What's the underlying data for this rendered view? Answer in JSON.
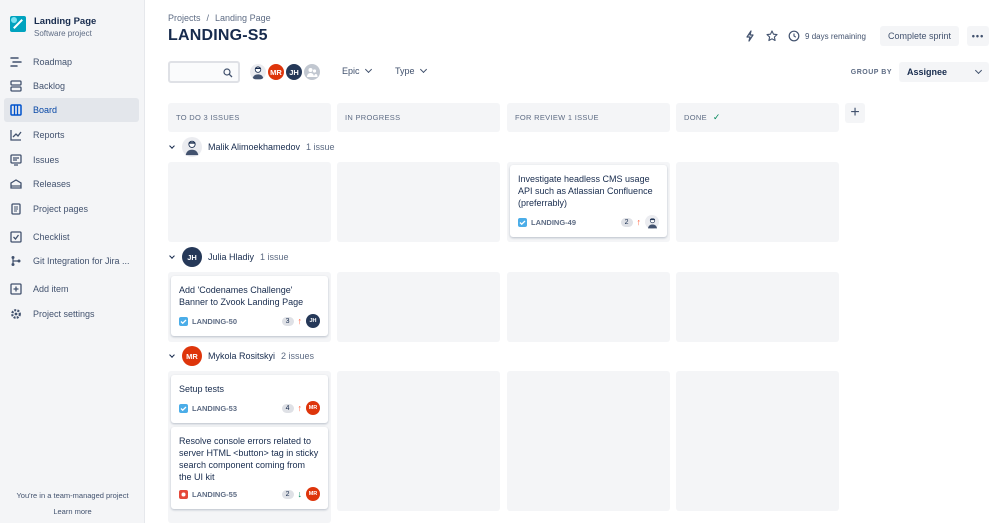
{
  "project": {
    "name": "Landing Page",
    "type": "Software project"
  },
  "sidebar": {
    "items": [
      {
        "label": "Roadmap",
        "icon": "roadmap-icon"
      },
      {
        "label": "Backlog",
        "icon": "backlog-icon"
      },
      {
        "label": "Board",
        "icon": "board-icon",
        "active": true
      },
      {
        "label": "Reports",
        "icon": "reports-icon"
      },
      {
        "label": "Issues",
        "icon": "issues-icon"
      },
      {
        "label": "Releases",
        "icon": "releases-icon"
      },
      {
        "label": "Project pages",
        "icon": "pages-icon"
      },
      {
        "label": "Checklist",
        "icon": "checklist-icon"
      },
      {
        "label": "Git Integration for Jira ...",
        "icon": "git-icon"
      },
      {
        "label": "Add item",
        "icon": "add-item-icon"
      },
      {
        "label": "Project settings",
        "icon": "gear-icon"
      }
    ],
    "footer_text": "You're in a team-managed project",
    "footer_link": "Learn more"
  },
  "breadcrumb": {
    "projects": "Projects",
    "sep": "/",
    "project": "Landing Page"
  },
  "page_title": "LANDING-S5",
  "header": {
    "days_remaining": "9 days remaining",
    "complete_sprint": "Complete sprint",
    "more": "•••"
  },
  "filters": {
    "search_placeholder": "",
    "avatars": [
      "",
      "MR",
      "JH",
      ""
    ],
    "epic": "Epic",
    "type": "Type",
    "group_by_label": "GROUP BY",
    "group_by_value": "Assignee"
  },
  "columns": [
    {
      "label": "TO DO 3 ISSUES"
    },
    {
      "label": "IN PROGRESS"
    },
    {
      "label": "FOR REVIEW 1 ISSUE"
    },
    {
      "label": "DONE"
    }
  ],
  "add_column": "+",
  "swimlanes": [
    {
      "assignee": "Malik Alimoekhamedov",
      "count": "1 issue",
      "initials": "",
      "cards": [
        {
          "title": "Investigate headless CMS usage API such as Atlassian Confluence (preferrably)",
          "key": "LANDING-49",
          "type": "task",
          "estimate": "2",
          "priority": "↑",
          "assignee_initials": ""
        }
      ]
    },
    {
      "assignee": "Julia Hladiy",
      "count": "1 issue",
      "initials": "JH",
      "cards": [
        {
          "title": "Add 'Codenames Challenge' Banner to Zvook Landing Page",
          "key": "LANDING-50",
          "type": "task",
          "estimate": "3",
          "priority": "↑",
          "assignee_initials": "JH"
        }
      ]
    },
    {
      "assignee": "Mykola Rositskyi",
      "count": "2 issues",
      "initials": "MR",
      "cards": [
        {
          "title": "Setup tests",
          "key": "LANDING-53",
          "type": "task",
          "estimate": "4",
          "priority": "↑",
          "assignee_initials": "MR"
        },
        {
          "title": "Resolve console errors related to server HTML <button> tag in sticky search component coming from the UI kit",
          "key": "LANDING-55",
          "type": "bug",
          "estimate": "2",
          "priority": "↓",
          "assignee_initials": "MR"
        }
      ]
    }
  ],
  "colors": {
    "accent": "#0052cc",
    "mr": "#de350b",
    "jh": "#253858",
    "task": "#4bade8",
    "bug": "#e5493a"
  }
}
